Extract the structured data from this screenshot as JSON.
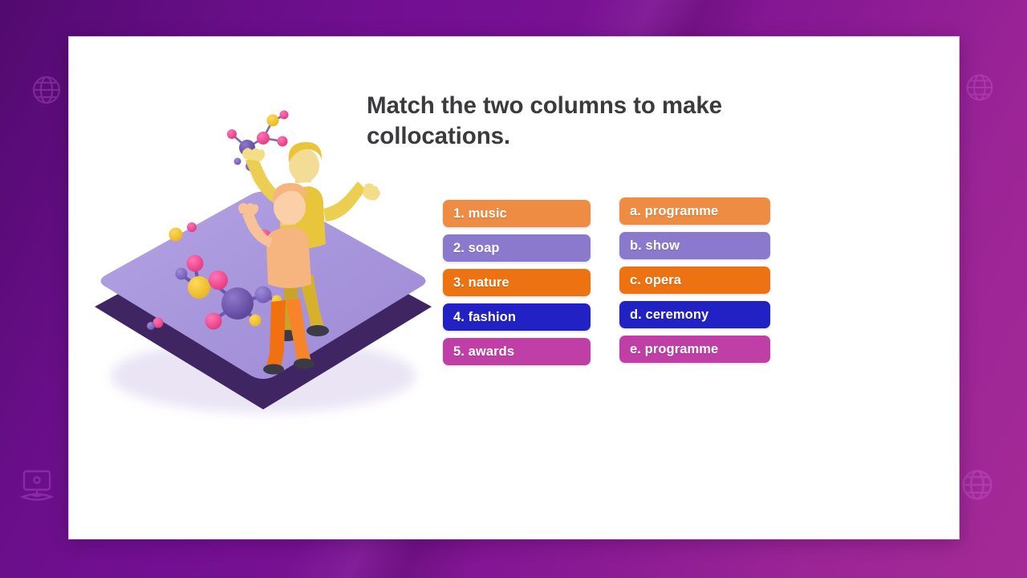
{
  "slide": {
    "title": "Match the two columns to make collocations."
  },
  "illustration": {
    "name": "isometric-platform-with-molecules-and-two-people",
    "platform_top_color": "#a896dd",
    "platform_side_color": "#3f2663",
    "adult_color": "#e8c53a",
    "child_color": "#f1700f",
    "molecule_colors": [
      "#7f66c2",
      "#e8417f",
      "#efc32c",
      "#f06ab0"
    ]
  },
  "exercise": {
    "left_column": [
      {
        "label": "1. music",
        "color": "#ef8c43"
      },
      {
        "label": "2. soap",
        "color": "#8b79cd"
      },
      {
        "label": "3. nature",
        "color": "#ed7211"
      },
      {
        "label": "4. fashion",
        "color": "#2222c4"
      },
      {
        "label": "5. awards",
        "color": "#c03fa7"
      }
    ],
    "right_column": [
      {
        "label": "a. programme",
        "color": "#ef8c43"
      },
      {
        "label": "b. show",
        "color": "#8b79cd"
      },
      {
        "label": "c. opera",
        "color": "#ed7211"
      },
      {
        "label": "d. ceremony",
        "color": "#2222c4"
      },
      {
        "label": "e. programme",
        "color": "#c03fa7"
      }
    ]
  },
  "decorations": [
    {
      "name": "globe-icon",
      "position": "top-left"
    },
    {
      "name": "globe-icon",
      "position": "top-right"
    },
    {
      "name": "computer-icon",
      "position": "bottom-left"
    },
    {
      "name": "globe-icon",
      "position": "bottom-right"
    }
  ],
  "theme": {
    "background_start": "#5d0b7e",
    "background_end": "#a42a96",
    "panel": "#ffffff",
    "title_color": "#3b3b3f"
  }
}
